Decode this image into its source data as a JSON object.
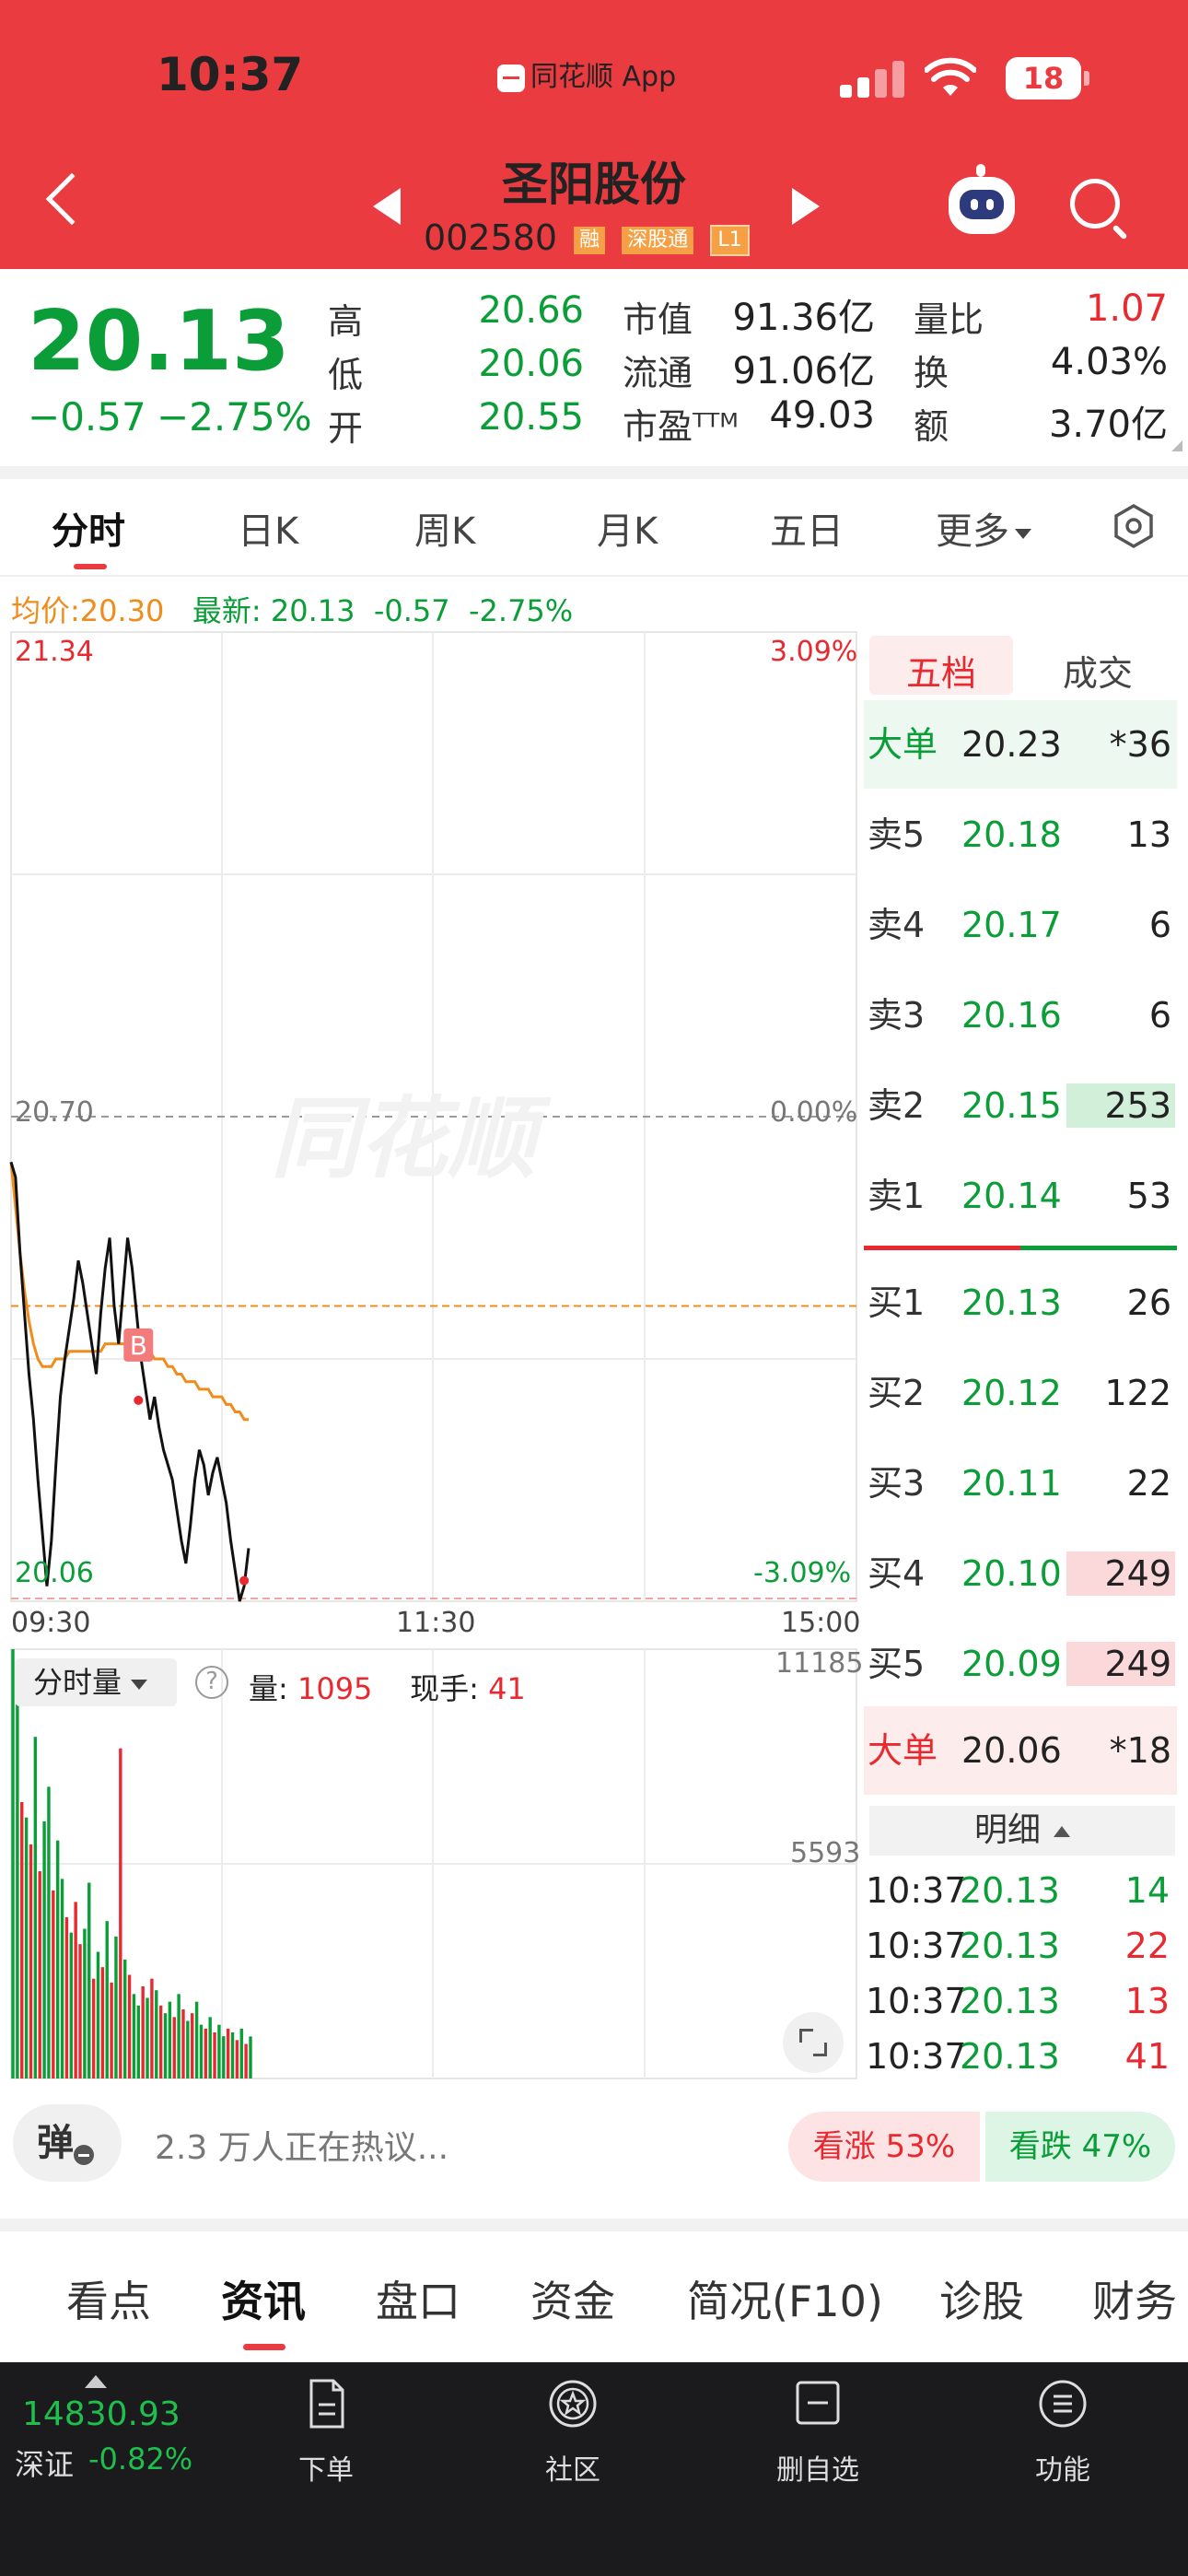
{
  "status_bar": {
    "time": "10:37",
    "app_name": "同花顺 App",
    "battery": "18"
  },
  "header": {
    "stock_name": "圣阳股份",
    "stock_code": "002580",
    "tags": [
      "融",
      "深股通",
      "L1"
    ],
    "icons": [
      "back-icon",
      "prev-stock-icon",
      "next-stock-icon",
      "robot-assistant-icon",
      "search-icon"
    ]
  },
  "quote": {
    "price": "20.13",
    "change": "−0.57",
    "change_pct": "−2.75%",
    "high_label": "高",
    "high": "20.66",
    "low_label": "低",
    "low": "20.06",
    "open_label": "开",
    "open": "20.55",
    "mkt_cap_label": "市值",
    "mkt_cap": "91.36亿",
    "float_cap_label": "流通",
    "float_cap": "91.06亿",
    "pe_label": "市盈ᵀᵀᴹ",
    "pe": "49.03",
    "vol_ratio_label": "量比",
    "vol_ratio": "1.07",
    "turnover_label": "换",
    "turnover": "4.03%",
    "amount_label": "额",
    "amount": "3.70亿"
  },
  "kline_tabs": [
    "分时",
    "日K",
    "周K",
    "月K",
    "五日",
    "更多"
  ],
  "avg_line": {
    "avg_label": "均价:",
    "avg": "20.30",
    "latest_label": "最新:",
    "latest": "20.13",
    "chg": "-0.57",
    "pct": "-2.75%"
  },
  "chart_data": {
    "type": "line",
    "title": "",
    "ylim": [
      20.06,
      21.34
    ],
    "y_labels": {
      "top": "21.34",
      "mid": "20.70",
      "bottom": "20.06"
    },
    "pct_labels": {
      "top": "3.09%",
      "mid": "0.00%",
      "bottom": "-3.09%"
    },
    "x_ticks": [
      "09:30",
      "11:30",
      "15:00"
    ],
    "watermark": "同花顺",
    "series": [
      {
        "values": [
          20.64,
          20.62,
          20.52,
          20.44,
          20.36,
          20.3,
          20.22,
          20.15,
          20.08,
          20.14,
          20.24,
          20.33,
          20.38,
          20.42,
          20.46,
          20.51,
          20.48,
          20.44,
          20.4,
          20.36,
          20.44,
          20.5,
          20.54,
          20.45,
          20.4,
          20.47,
          20.54,
          20.5,
          20.44,
          20.38,
          20.34,
          20.3,
          20.33,
          20.29,
          20.26,
          20.24,
          20.22,
          20.18,
          20.14,
          20.11,
          20.16,
          20.22,
          20.26,
          20.24,
          20.2,
          20.23,
          20.25,
          20.22,
          20.19,
          20.14,
          20.1,
          20.06,
          20.08,
          20.13
        ]
      },
      {
        "values": [
          20.64,
          20.58,
          20.52,
          20.47,
          20.43,
          20.4,
          20.38,
          20.37,
          20.37,
          20.37,
          20.38,
          20.38,
          20.38,
          20.39,
          20.39,
          20.39,
          20.39,
          20.39,
          20.39,
          20.39,
          20.39,
          20.4,
          20.4,
          20.4,
          20.4,
          20.4,
          20.4,
          20.4,
          20.4,
          20.39,
          20.39,
          20.39,
          20.38,
          20.38,
          20.38,
          20.37,
          20.37,
          20.36,
          20.36,
          20.35,
          20.35,
          20.35,
          20.34,
          20.34,
          20.34,
          20.33,
          20.33,
          20.33,
          20.32,
          20.32,
          20.31,
          20.31,
          20.3,
          20.3
        ]
      }
    ],
    "markers": [
      {
        "label": "B",
        "index": 28,
        "value": 20.34
      }
    ],
    "volume": {
      "ylim": [
        0,
        11185
      ],
      "y_labels": {
        "top": "11185",
        "mid": "5593"
      },
      "values": [
        11185,
        9800,
        7200,
        6800,
        6100,
        8900,
        5400,
        6700,
        7600,
        4900,
        6200,
        5200,
        4200,
        3800,
        4600,
        3500,
        3900,
        5100,
        2600,
        3300,
        2900,
        4100,
        2500,
        3700,
        8600,
        3100,
        2700,
        2200,
        1900,
        2400,
        2100,
        2600,
        2300,
        1900,
        1700,
        2000,
        1600,
        2200,
        1800,
        1500,
        1700,
        2000,
        1400,
        1300,
        1600,
        1200,
        1400,
        1100,
        1300,
        1200,
        1000,
        1300,
        900,
        1095
      ],
      "colors": [
        "g",
        "g",
        "r",
        "g",
        "r",
        "g",
        "r",
        "g",
        "g",
        "r",
        "g",
        "g",
        "r",
        "g",
        "r",
        "r",
        "g",
        "g",
        "r",
        "g",
        "r",
        "g",
        "r",
        "g",
        "r",
        "g",
        "r",
        "g",
        "g",
        "r",
        "g",
        "r",
        "g",
        "r",
        "g",
        "g",
        "r",
        "g",
        "r",
        "g",
        "r",
        "g",
        "g",
        "r",
        "g",
        "r",
        "g",
        "g",
        "r",
        "g",
        "r",
        "g",
        "r",
        "g"
      ]
    }
  },
  "volume_panel": {
    "mode": "分时量",
    "qty_label": "量:",
    "qty": "1095",
    "hand_label": "现手:",
    "hand": "41"
  },
  "order_book": {
    "tabs": [
      "五档",
      "成交"
    ],
    "big_sell": {
      "label": "大单",
      "price": "20.23",
      "vol": "*36"
    },
    "asks": [
      {
        "label": "卖5",
        "price": "20.18",
        "vol": "13",
        "bar": 0.0
      },
      {
        "label": "卖4",
        "price": "20.17",
        "vol": "6",
        "bar": 0.0
      },
      {
        "label": "卖3",
        "price": "20.16",
        "vol": "6",
        "bar": 0.0
      },
      {
        "label": "卖2",
        "price": "20.15",
        "vol": "253",
        "bar": 1.0
      },
      {
        "label": "卖1",
        "price": "20.14",
        "vol": "53",
        "bar": 0.0
      }
    ],
    "bids": [
      {
        "label": "买1",
        "price": "20.13",
        "vol": "26",
        "bar": 0.0
      },
      {
        "label": "买2",
        "price": "20.12",
        "vol": "122",
        "bar": 0.0
      },
      {
        "label": "买3",
        "price": "20.11",
        "vol": "22",
        "bar": 0.0
      },
      {
        "label": "买4",
        "price": "20.10",
        "vol": "249",
        "bar": 1.0
      },
      {
        "label": "买5",
        "price": "20.09",
        "vol": "249",
        "bar": 1.0
      }
    ],
    "big_buy": {
      "label": "大单",
      "price": "20.06",
      "vol": "*18"
    },
    "detail_label": "明细",
    "ticks": [
      {
        "time": "10:37",
        "price": "20.13",
        "vol": "14",
        "side": "sell"
      },
      {
        "time": "10:37",
        "price": "20.13",
        "vol": "22",
        "side": "buy"
      },
      {
        "time": "10:37",
        "price": "20.13",
        "vol": "13",
        "side": "buy"
      },
      {
        "time": "10:37",
        "price": "20.13",
        "vol": "41",
        "side": "buy"
      }
    ]
  },
  "discussion": {
    "danmu": "弹",
    "text": "2.3 万人正在热议...",
    "bull": "看涨 53%",
    "bear": "看跌 47%"
  },
  "news_tabs": [
    "看点",
    "资讯",
    "盘口",
    "资金",
    "简况(F10)",
    "诊股",
    "财务"
  ],
  "bottom_bar": {
    "index_value": "14830.93",
    "index_name": "深证",
    "index_pct": "-0.82%",
    "nav": [
      {
        "label": "下单",
        "icon": "document-icon"
      },
      {
        "label": "社区",
        "icon": "community-star-icon"
      },
      {
        "label": "删自选",
        "icon": "remove-watchlist-icon"
      },
      {
        "label": "功能",
        "icon": "menu-icon"
      }
    ]
  },
  "colors": {
    "header": "#ea3b40",
    "up": "#e8292f",
    "down": "#0a9d38",
    "avg_line": "#f08c1c"
  }
}
